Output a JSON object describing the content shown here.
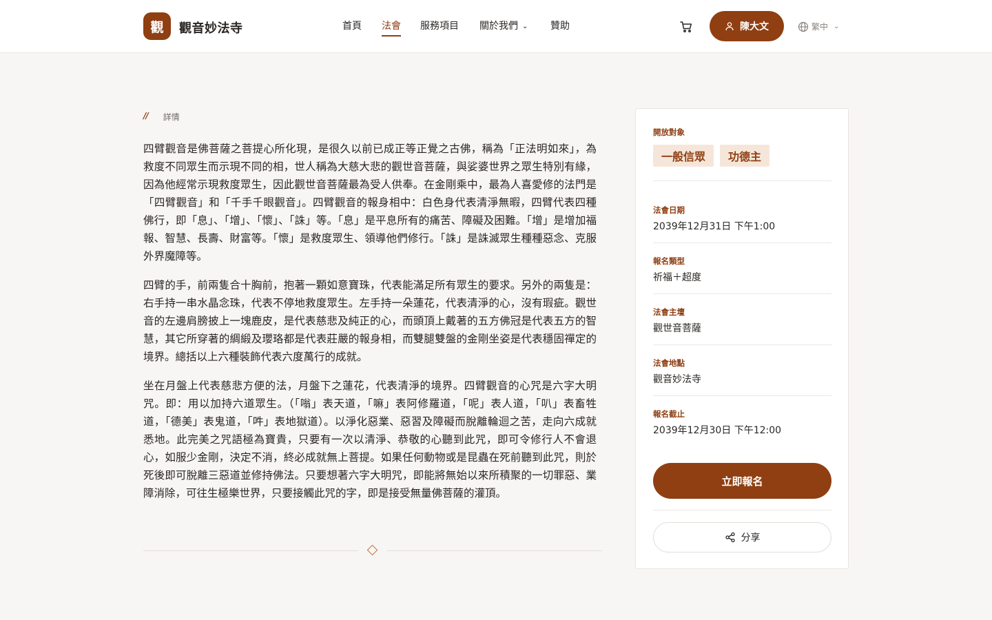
{
  "header": {
    "logo_char": "觀",
    "site_name": "觀音妙法寺",
    "nav": [
      {
        "label": "首頁"
      },
      {
        "label": "法會"
      },
      {
        "label": "服務項目"
      },
      {
        "label": "關於我們"
      },
      {
        "label": "贊助"
      }
    ],
    "user_name": "陳大文",
    "language": "繁中"
  },
  "breadcrumb": {
    "separator": "//",
    "current": "詳情"
  },
  "article": {
    "paragraphs": [
      "四臂觀音是佛菩薩之菩提心所化現，是很久以前已成正等正覺之古佛，稱為「正法明如來」，為救度不同眾生而示現不同的相，世人稱為大慈大悲的觀世音菩薩，與娑婆世界之眾生特別有緣，因為他經常示現救度眾生，因此觀世音菩薩最為受人供奉。在金剛乘中，最為人喜愛修的法門是「四臂觀音」和「千手千眼觀音」。四臂觀音的報身相中：白色身代表清淨無暇，四臂代表四種佛行，即「息」、「增」、「懷」、「誅」等。「息」是平息所有的痛苦、障礙及困難。「增」是增加福報、智慧、長壽、財富等。「懷」是救度眾生、領導他們修行。「誅」是誅滅眾生種種惡念、克服外界魔障等。",
      "四臂的手，前兩隻合十胸前，抱著一顆如意寶珠，代表能滿足所有眾生的要求。另外的兩隻是：右手持一串水晶念珠，代表不停地救度眾生。左手持一朵蓮花，代表清淨的心，沒有瑕疵。觀世音的左邊肩膀披上一塊鹿皮，是代表慈悲及純正的心，而頭頂上戴著的五方佛冠是代表五方的智慧，其它所穿著的綢緞及瓔珞都是代表莊嚴的報身相，而雙腿雙盤的金剛坐姿是代表穩固禪定的境界。總括以上六種裝飾代表六度萬行的成就。",
      "坐在月盤上代表慈悲方便的法，月盤下之蓮花，代表清淨的境界。四臂觀音的心咒是六字大明咒。即：用以加持六道眾生。（「嗡」表天道，「嘛」表阿修羅道，「呢」表人道，「叭」表畜牲道，「德美」表鬼道，「吽」表地獄道）。以淨化惡業、惡習及障礙而脫離輪迴之苦，走向六成就悉地。此完美之咒語極為寶貴，只要有一次以清淨、恭敬的心聽到此咒，即可令修行人不會退心，如服少金剛，決定不消，終必成就無上菩提。如果任何動物或是昆蟲在死前聽到此咒，則於死後即可脫離三惡道並修持佛法。只要想著六字大明咒，即能將無始以來所積聚的一切罪惡、業障消除，可往生極樂世界，只要接觸此咒的字，即是接受無量佛菩薩的灌頂。"
    ]
  },
  "sidebar": {
    "audience_label": "開放對象",
    "audience_tags": [
      "一般信眾",
      "功德主"
    ],
    "date_label": "法會日期",
    "date_value": "2039年12月31日 下午1:00",
    "type_label": "報名類型",
    "type_value": "祈福＋超度",
    "deity_label": "法會主壇",
    "deity_value": "觀世音菩薩",
    "venue_label": "法會地點",
    "venue_value": "觀音妙法寺",
    "deadline_label": "報名截止",
    "deadline_value": "2039年12月30日 下午12:00",
    "register_label": "立即報名",
    "share_label": "分享"
  },
  "colors": {
    "accent": "#8f3f12",
    "tag_bg": "#f6e6da",
    "page_bg": "#f7f6f4"
  }
}
